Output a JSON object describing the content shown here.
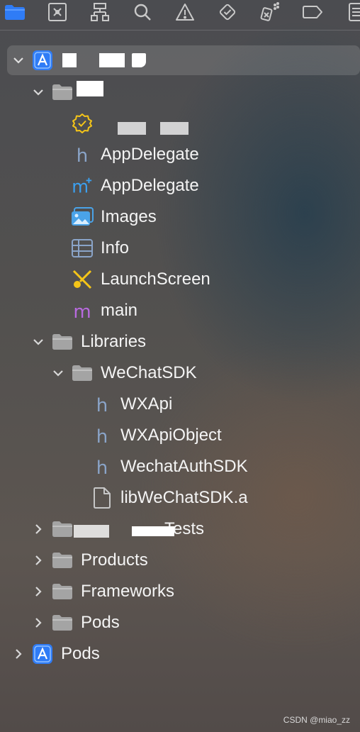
{
  "toolbar": {
    "icons": [
      "folder-icon",
      "source-control-icon",
      "hierarchy-icon",
      "search-icon",
      "issue-warning-icon",
      "test-diamond-icon",
      "debug-spray-icon",
      "breakpoint-tag-icon",
      "report-list-icon"
    ]
  },
  "tree": {
    "items": [
      {
        "label": ""
      },
      {
        "label": ""
      },
      {
        "label": ""
      },
      {
        "label": "AppDelegate"
      },
      {
        "label": "AppDelegate"
      },
      {
        "label": "Images"
      },
      {
        "label": "Info"
      },
      {
        "label": "LaunchScreen"
      },
      {
        "label": "main"
      },
      {
        "label": "Libraries"
      },
      {
        "label": "WeChatSDK"
      },
      {
        "label": "WXApi"
      },
      {
        "label": "WXApiObject"
      },
      {
        "label": "WechatAuthSDK"
      },
      {
        "label": "libWeChatSDK.a"
      },
      {
        "label": "Tests"
      },
      {
        "label": "Products"
      },
      {
        "label": "Frameworks"
      },
      {
        "label": "Pods"
      },
      {
        "label": "Pods"
      }
    ]
  },
  "watermark": "CSDN @miao_zz",
  "colors": {
    "accent": "#2f7cf6",
    "header_h": "#8aa4c8",
    "swift_m": "#b86adf",
    "warning_yellow": "#f5c518"
  }
}
